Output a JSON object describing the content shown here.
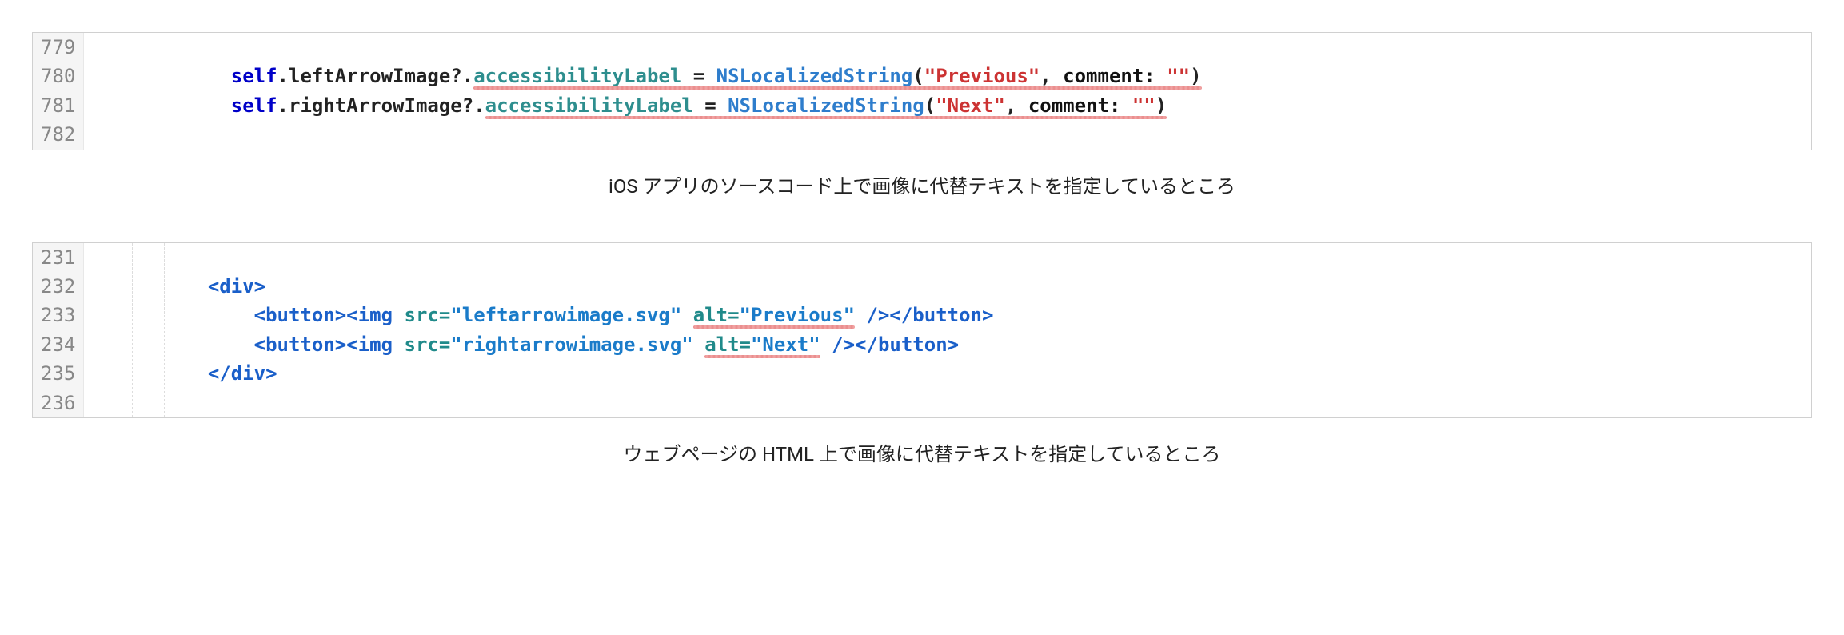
{
  "block1": {
    "line_numbers": [
      "779",
      "780",
      "781",
      "782"
    ],
    "lines": {
      "l0": "",
      "l1": {
        "indent": "            ",
        "keyword": "self",
        "dot1": ".",
        "prop1": "leftArrowImage",
        "optq": "?",
        "dot2": ".",
        "member": "accessibilityLabel",
        "eq": " = ",
        "func": "NSLocalizedString",
        "open": "(",
        "str1": "\"Previous\"",
        "comma": ", ",
        "argl": "comment:",
        "sp": " ",
        "str2": "\"\"",
        "close": ")"
      },
      "l2": {
        "indent": "            ",
        "keyword": "self",
        "dot1": ".",
        "prop1": "rightArrowImage",
        "optq": "?",
        "dot2": ".",
        "member": "accessibilityLabel",
        "eq": " = ",
        "func": "NSLocalizedString",
        "open": "(",
        "str1": "\"Next\"",
        "comma": ", ",
        "argl": "comment:",
        "sp": " ",
        "str2": "\"\"",
        "close": ")"
      },
      "l3": ""
    }
  },
  "caption1": "iOS アプリのソースコード上で画像に代替テキストを指定しているところ",
  "block2": {
    "line_numbers": [
      "231",
      "232",
      "233",
      "234",
      "235",
      "236"
    ],
    "lines": {
      "l0": "",
      "l1": {
        "indent": "          ",
        "open": "<div>"
      },
      "l2": {
        "indent": "              ",
        "btn_open": "<button>",
        "img_open": "<img",
        "sp1": " ",
        "src_attr": "src=",
        "src_val": "\"leftarrowimage.svg\"",
        "sp2": " ",
        "alt_attr": "alt=",
        "alt_val": "\"Previous\"",
        "sp3": " ",
        "img_close": "/>",
        "btn_close": "</button>"
      },
      "l3": {
        "indent": "              ",
        "btn_open": "<button>",
        "img_open": "<img",
        "sp1": " ",
        "src_attr": "src=",
        "src_val": "\"rightarrowimage.svg\"",
        "sp2": " ",
        "alt_attr": "alt=",
        "alt_val": "\"Next\"",
        "sp3": " ",
        "img_close": "/>",
        "btn_close": "</button>"
      },
      "l4": {
        "indent": "          ",
        "close": "</div>"
      },
      "l5": ""
    }
  },
  "caption2": "ウェブページの HTML 上で画像に代替テキストを指定しているところ"
}
